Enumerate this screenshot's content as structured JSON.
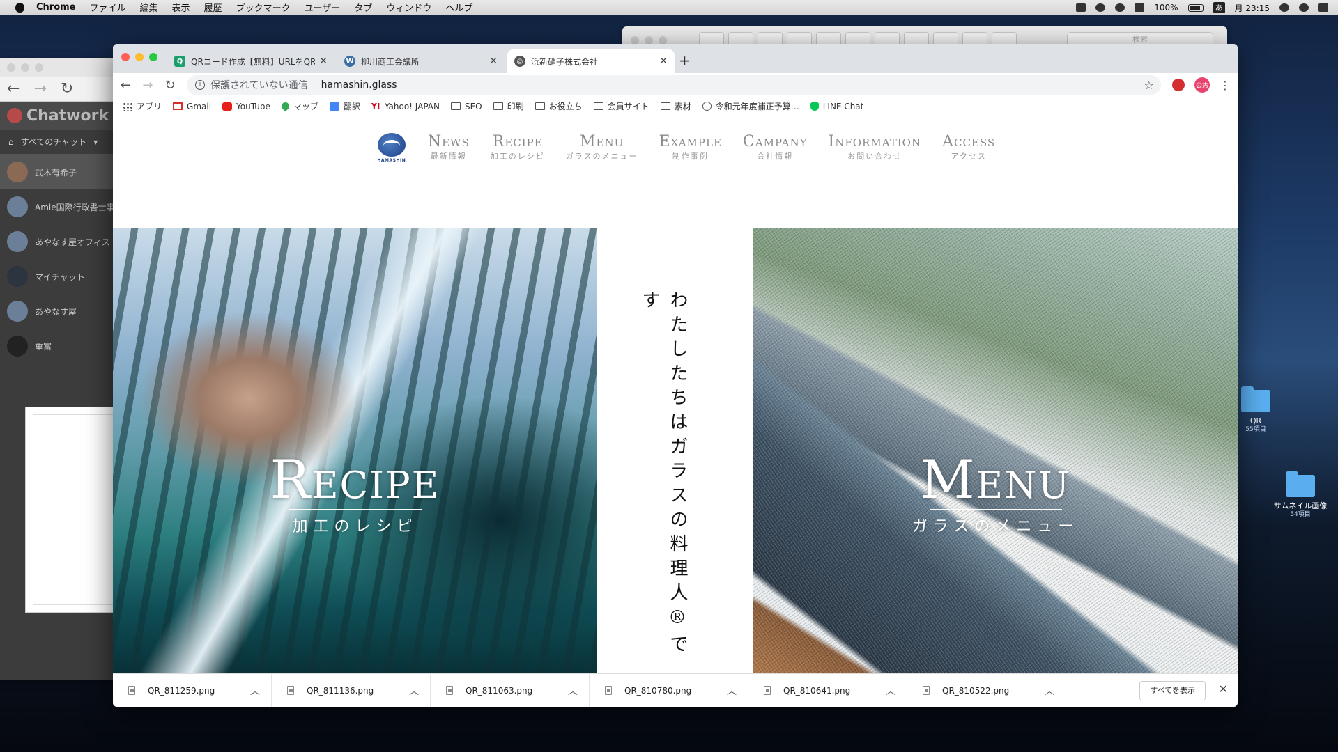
{
  "menubar": {
    "app": "Chrome",
    "items": [
      "ファイル",
      "編集",
      "表示",
      "履歴",
      "ブックマーク",
      "ユーザー",
      "タブ",
      "ウィンドウ",
      "ヘルプ"
    ],
    "battery": "100%",
    "ime": "あ",
    "clock": "月 23:15"
  },
  "finder_window": {
    "search_placeholder": "検索"
  },
  "chatwork": {
    "logo": "Chatwork",
    "filter": "すべてのチャット",
    "rooms": [
      "武木有希子",
      "Amie国際行政書士事",
      "あやなす屋オフィス",
      "マイチャット",
      "あやなす屋",
      "重富"
    ]
  },
  "desktop": {
    "icons": [
      {
        "name": "QR",
        "sub": "55項目"
      },
      {
        "name": "サムネイル画像",
        "sub": "54項目"
      }
    ]
  },
  "browser": {
    "tabs": [
      {
        "title": "QRコード作成【無料】URLをQR…",
        "favicon": "qr-favicon"
      },
      {
        "title": "柳川商工会議所",
        "favicon": "wordpress-favicon"
      },
      {
        "title": "浜新硝子株式会社",
        "favicon": "globe-favicon"
      }
    ],
    "address": {
      "security": "保護されていない通信",
      "url": "hamashin.glass"
    },
    "ext_badge": "公志",
    "bookmarks": [
      {
        "label": "アプリ",
        "icon": "apps-icon"
      },
      {
        "label": "Gmail",
        "icon": "gmail-icon"
      },
      {
        "label": "YouTube",
        "icon": "youtube-icon"
      },
      {
        "label": "マップ",
        "icon": "maps-icon"
      },
      {
        "label": "翻訳",
        "icon": "translate-icon"
      },
      {
        "label": "Yahoo! JAPAN",
        "icon": "yahoo-icon"
      },
      {
        "label": "SEO",
        "icon": "folder-icon"
      },
      {
        "label": "印刷",
        "icon": "folder-icon"
      },
      {
        "label": "お役立ち",
        "icon": "folder-icon"
      },
      {
        "label": "会員サイト",
        "icon": "folder-icon"
      },
      {
        "label": "素材",
        "icon": "folder-icon"
      },
      {
        "label": "令和元年度補正予算…",
        "icon": "globe-icon"
      },
      {
        "label": "LINE Chat",
        "icon": "line-icon"
      }
    ]
  },
  "site": {
    "logo_text": "HAMASHIN",
    "nav": [
      {
        "en": "News",
        "jp": "最新情報"
      },
      {
        "en": "Recipe",
        "jp": "加工のレシピ"
      },
      {
        "en": "Menu",
        "jp": "ガラスのメニュー"
      },
      {
        "en": "Example",
        "jp": "制作事例"
      },
      {
        "en": "Campany",
        "jp": "会社情報"
      },
      {
        "en": "Information",
        "jp": "お問い合わせ"
      },
      {
        "en": "Access",
        "jp": "アクセス"
      }
    ],
    "recipe": {
      "title": "Recipe",
      "subtitle": "加工のレシピ"
    },
    "menu": {
      "title": "Menu",
      "subtitle": "ガラスのメニュー"
    },
    "tagline": "わたしたちはガラスの料理人®です"
  },
  "downloads": {
    "files": [
      "QR_811259.png",
      "QR_811136.png",
      "QR_811063.png",
      "QR_810780.png",
      "QR_810641.png",
      "QR_810522.png"
    ],
    "show_all": "すべてを表示"
  }
}
